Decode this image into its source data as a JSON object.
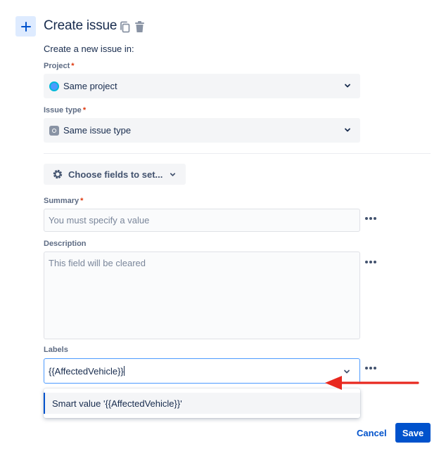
{
  "header": {
    "title": "Create issue",
    "subtitle": "Create a new issue in:",
    "add_icon": "plus-icon",
    "copy_icon": "copy-icon",
    "delete_icon": "trash-icon"
  },
  "project": {
    "label": "Project",
    "required": "*",
    "value": "Same project",
    "icon": "project-avatar-icon"
  },
  "issue_type": {
    "label": "Issue type",
    "required": "*",
    "value": "Same issue type",
    "icon": "issue-type-icon"
  },
  "choose_fields": {
    "label": "Choose fields to set...",
    "icon": "gear-icon"
  },
  "summary": {
    "label": "Summary",
    "required": "*",
    "placeholder": "You must specify a value"
  },
  "description": {
    "label": "Description",
    "placeholder": "This field will be cleared"
  },
  "labels": {
    "label": "Labels",
    "value": "{{AffectedVehicle}}"
  },
  "dropdown": {
    "options": [
      "Smart value '{{AffectedVehicle}}'"
    ]
  },
  "actions": {
    "cancel": "Cancel",
    "save": "Save"
  },
  "colors": {
    "primary": "#0052cc",
    "required": "#de350b",
    "annotation_arrow": "#e8281f"
  }
}
